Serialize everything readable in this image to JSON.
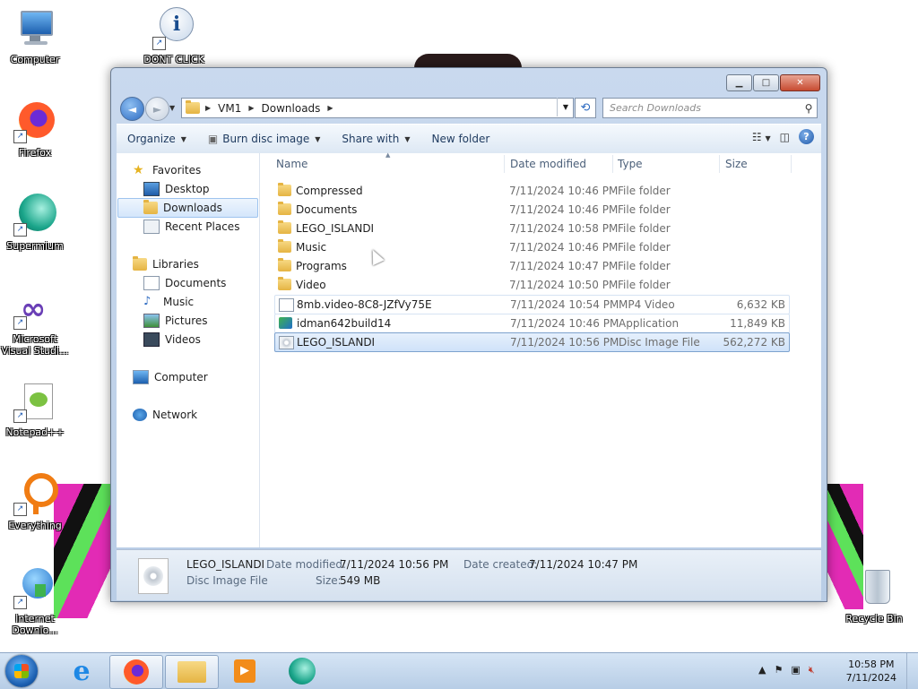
{
  "desktop": {
    "icons": [
      {
        "label": "Computer"
      },
      {
        "label": "DONT CLICK"
      },
      {
        "label": "Firefox"
      },
      {
        "label": "Supermium"
      },
      {
        "label": "Microsoft Visual Studi..."
      },
      {
        "label": "Notepad++"
      },
      {
        "label": "Everything"
      },
      {
        "label": "Internet Downlo..."
      },
      {
        "label": "Recycle Bin"
      }
    ]
  },
  "window": {
    "caption_buttons": {
      "minimize": "▁",
      "maximize": "□",
      "close": "✕"
    },
    "address": {
      "crumbs": [
        "VM1",
        "Downloads"
      ]
    },
    "search": {
      "placeholder": "Search Downloads"
    },
    "toolbar": {
      "organize": "Organize",
      "burn": "Burn disc image",
      "share": "Share with",
      "new_folder": "New folder"
    },
    "nav_pane": {
      "favorites": "Favorites",
      "desktop": "Desktop",
      "downloads": "Downloads",
      "recent": "Recent Places",
      "libraries": "Libraries",
      "documents": "Documents",
      "music": "Music",
      "pictures": "Pictures",
      "videos": "Videos",
      "computer": "Computer",
      "network": "Network"
    },
    "columns": {
      "name": "Name",
      "date": "Date modified",
      "type": "Type",
      "size": "Size"
    },
    "files": [
      {
        "name": "Compressed",
        "date": "7/11/2024 10:46 PM",
        "type": "File folder",
        "size": ""
      },
      {
        "name": "Documents",
        "date": "7/11/2024 10:46 PM",
        "type": "File folder",
        "size": ""
      },
      {
        "name": "LEGO_ISLANDI",
        "date": "7/11/2024 10:58 PM",
        "type": "File folder",
        "size": ""
      },
      {
        "name": "Music",
        "date": "7/11/2024 10:46 PM",
        "type": "File folder",
        "size": ""
      },
      {
        "name": "Programs",
        "date": "7/11/2024 10:47 PM",
        "type": "File folder",
        "size": ""
      },
      {
        "name": "Video",
        "date": "7/11/2024 10:50 PM",
        "type": "File folder",
        "size": ""
      },
      {
        "name": "8mb.video-8C8-JZfVy75E",
        "date": "7/11/2024 10:54 PM",
        "type": "MP4 Video",
        "size": "6,632 KB"
      },
      {
        "name": "idman642build14",
        "date": "7/11/2024 10:46 PM",
        "type": "Application",
        "size": "11,849 KB"
      },
      {
        "name": "LEGO_ISLANDI",
        "date": "7/11/2024 10:56 PM",
        "type": "Disc Image File",
        "size": "562,272 KB"
      }
    ],
    "details": {
      "name": "LEGO_ISLANDI",
      "type": "Disc Image File",
      "date_modified_label": "Date modified:",
      "date_modified": "7/11/2024 10:56 PM",
      "size_label": "Size:",
      "size": "549 MB",
      "date_created_label": "Date created:",
      "date_created": "7/11/2024 10:47 PM"
    }
  },
  "taskbar": {
    "time": "10:58 PM",
    "date": "7/11/2024"
  },
  "colors": {
    "accent": "#2d6bc2",
    "selection": "#cfe2f9"
  }
}
